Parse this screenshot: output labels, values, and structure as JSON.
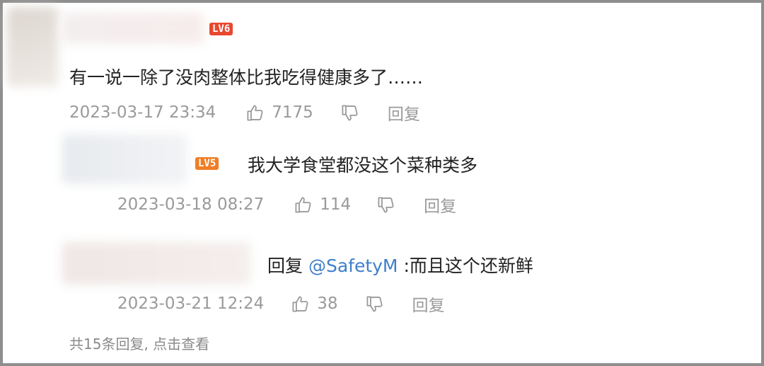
{
  "comments": [
    {
      "level": "LV6",
      "level_color": "#e8482f",
      "text": "有一说一除了没肉整体比我吃得健康多了……",
      "date": "2023-03-17 23:34",
      "likes": "7175",
      "reply_label": "回复"
    },
    {
      "level": "LV5",
      "level_color": "#f07e26",
      "text": "我大学食堂都没这个菜种类多",
      "date": "2023-03-18 08:27",
      "likes": "114",
      "reply_label": "回复"
    },
    {
      "reply_prefix": "回复",
      "mention": "@SafetyM",
      "text": ":而且这个还新鲜",
      "date": "2023-03-21 12:24",
      "likes": "38",
      "reply_label": "回复"
    }
  ],
  "footer": {
    "more_replies": "共15条回复, 点击查看"
  },
  "icons": {
    "like": "thumbs-up-icon",
    "dislike": "thumbs-down-icon"
  },
  "colors": {
    "text": "#222222",
    "meta": "#9a9a9a",
    "mention": "#3f7fc9"
  }
}
